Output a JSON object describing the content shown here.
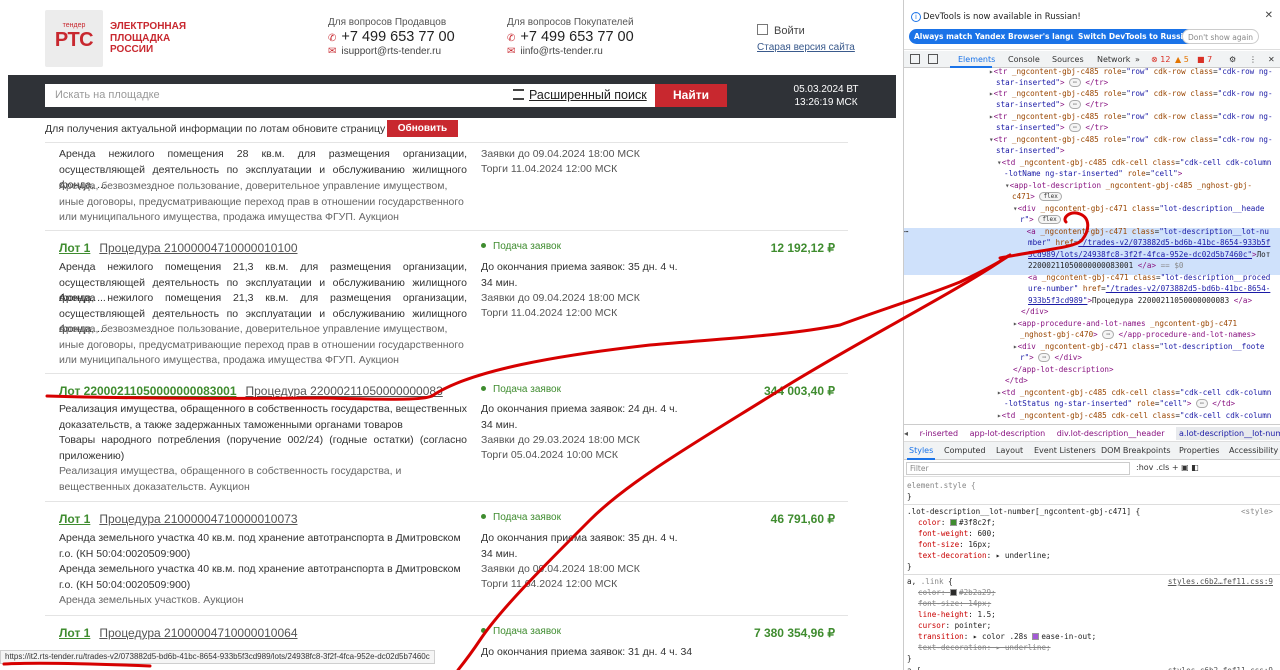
{
  "header": {
    "logo_small": "тендер",
    "logo_big": "РТС",
    "logo_text": [
      "ЭЛЕКТРОННАЯ",
      "ПЛОЩАДКА",
      "РОССИИ"
    ],
    "sellers_caption": "Для вопросов Продавцов",
    "sellers_phone": "+7 499 653 77 00",
    "sellers_email": "isupport@rts-tender.ru",
    "buyers_caption": "Для вопросов Покупателей",
    "buyers_phone": "+7 499 653 77 00",
    "buyers_email": "iinfo@rts-tender.ru",
    "login_label": "Войти",
    "old_version_link": "Старая версия сайта"
  },
  "search": {
    "placeholder": "Искать на площадке",
    "advanced_label": "Расширенный поиск",
    "find_button": "Найти",
    "date": "05.03.2024 ВТ",
    "time": "13:26:19 МСК"
  },
  "notice": {
    "text": "Для получения актуальной информации по лотам обновите страницу",
    "refresh_button": "Обновить"
  },
  "lots": [
    {
      "lot_label": "",
      "procedure": "",
      "description": "Аренда нежилого помещения 28 кв.м. для размещения организации, осуществляющей деятельность по эксплуатации и обслуживанию жилищного фонда, ...",
      "category": "Аренда, безвозмездное пользование, доверительное управление имуществом, иные договоры, предусматривающие переход прав в отношении государственного или муниципального имущества, продажа имущества ФГУП. Аукцион",
      "status": "",
      "remaining": "",
      "deadline": "Заявки до 09.04.2024 18:00 МСК",
      "auction": "Торги 11.04.2024 12:00 МСК",
      "price": ""
    },
    {
      "lot_label": "Лот 1",
      "procedure": "Процедура 21000004710000010100",
      "description": "Аренда нежилого помещения 21,3 кв.м. для размещения организации, осуществляющей деятельность по эксплуатации и обслуживанию жилищного фонда, ...",
      "description2": "Аренда нежилого помещения 21,3 кв.м. для размещения организации, осуществляющей деятельность по эксплуатации и обслуживанию жилищного фонда, ...",
      "category": "Аренда, безвозмездное пользование, доверительное управление имуществом, иные договоры, предусматривающие переход прав в отношении государственного или муниципального имущества, продажа имущества ФГУП. Аукцион",
      "status": "Подача заявок",
      "remaining": "До окончания приема заявок: 35 дн. 4 ч. 34 мин.",
      "deadline": "Заявки до 09.04.2024 18:00 МСК",
      "auction": "Торги 11.04.2024 12:00 МСК",
      "price": "12 192,12 ₽"
    },
    {
      "lot_label": "Лот 22000211050000000083001",
      "procedure": "Процедура 22000211050000000083",
      "description": "Реализация имущества, обращенного в собственность государства, вещественных доказательств, а также задержанных таможенными органами товаров",
      "description2": "Товары народного потребления (поручение 002/24) (годные остатки) (согласно приложению)",
      "category": "Реализация имущества, обращенного в собственность государства, и вещественных доказательств. Аукцион",
      "status": "Подача заявок",
      "remaining": "До окончания приема заявок: 24 дн. 4 ч. 34 мин.",
      "deadline": "Заявки до 29.03.2024 18:00 МСК",
      "auction": "Торги 05.04.2024 10:00 МСК",
      "price": "344 003,40 ₽"
    },
    {
      "lot_label": "Лот 1",
      "procedure": "Процедура 21000004710000010073",
      "description": "Аренда земельного участка 40 кв.м. под хранение автотранспорта в Дмитровском г.о. (КН 50:04:0020509:900)",
      "description2": "Аренда земельного участка 40 кв.м. под хранение автотранспорта в Дмитровском г.о. (КН 50:04:0020509:900)",
      "category": "Аренда земельных участков. Аукцион",
      "status": "Подача заявок",
      "remaining": "До окончания приема заявок: 35 дн. 4 ч. 34 мин.",
      "deadline": "Заявки до 09.04.2024 18:00 МСК",
      "auction": "Торги 11.04.2024 12:00 МСК",
      "price": "46 791,60 ₽"
    },
    {
      "lot_label": "Лот 1",
      "procedure": "Процедура 21000004710000010064",
      "status": "Подача заявок",
      "remaining": "До окончания приема заявок: 31 дн. 4 ч. 34",
      "price": "7 380 354,96 ₽"
    }
  ],
  "status_url": "https://it2.rts-tender.ru/trades-v2/073882d5-bd6b-41bc-8654-933b5f3cd989/lots/24938fc8-3f2f-4fca-952e-dc02d5b7460c",
  "devtools": {
    "info_text": "DevTools is now available in Russian!",
    "btn_match": "Always match Yandex Browser's language",
    "btn_switch": "Switch DevTools to Russian",
    "btn_dont": "Don't show again",
    "tabs": [
      "Elements",
      "Console",
      "Sources",
      "Network"
    ],
    "errors": "12",
    "warnings": "5",
    "issues": "7",
    "crumbs": [
      "r-inserted",
      "app-lot-description",
      "div.lot-description__header",
      "a.lot-description__lot-number"
    ],
    "sub_tabs": [
      "Styles",
      "Computed",
      "Layout",
      "Event Listeners",
      "DOM Breakpoints",
      "Properties",
      "Accessibility"
    ],
    "filter_placeholder": "Filter",
    "filter_tools": ":hov  .cls  +",
    "accent": "#1a73e8"
  },
  "colors": {
    "brand_red": "#c8282f",
    "lot_green": "#3f8c2f",
    "searchbar_bg": "#2f3237",
    "annotation_red": "#d60000"
  }
}
